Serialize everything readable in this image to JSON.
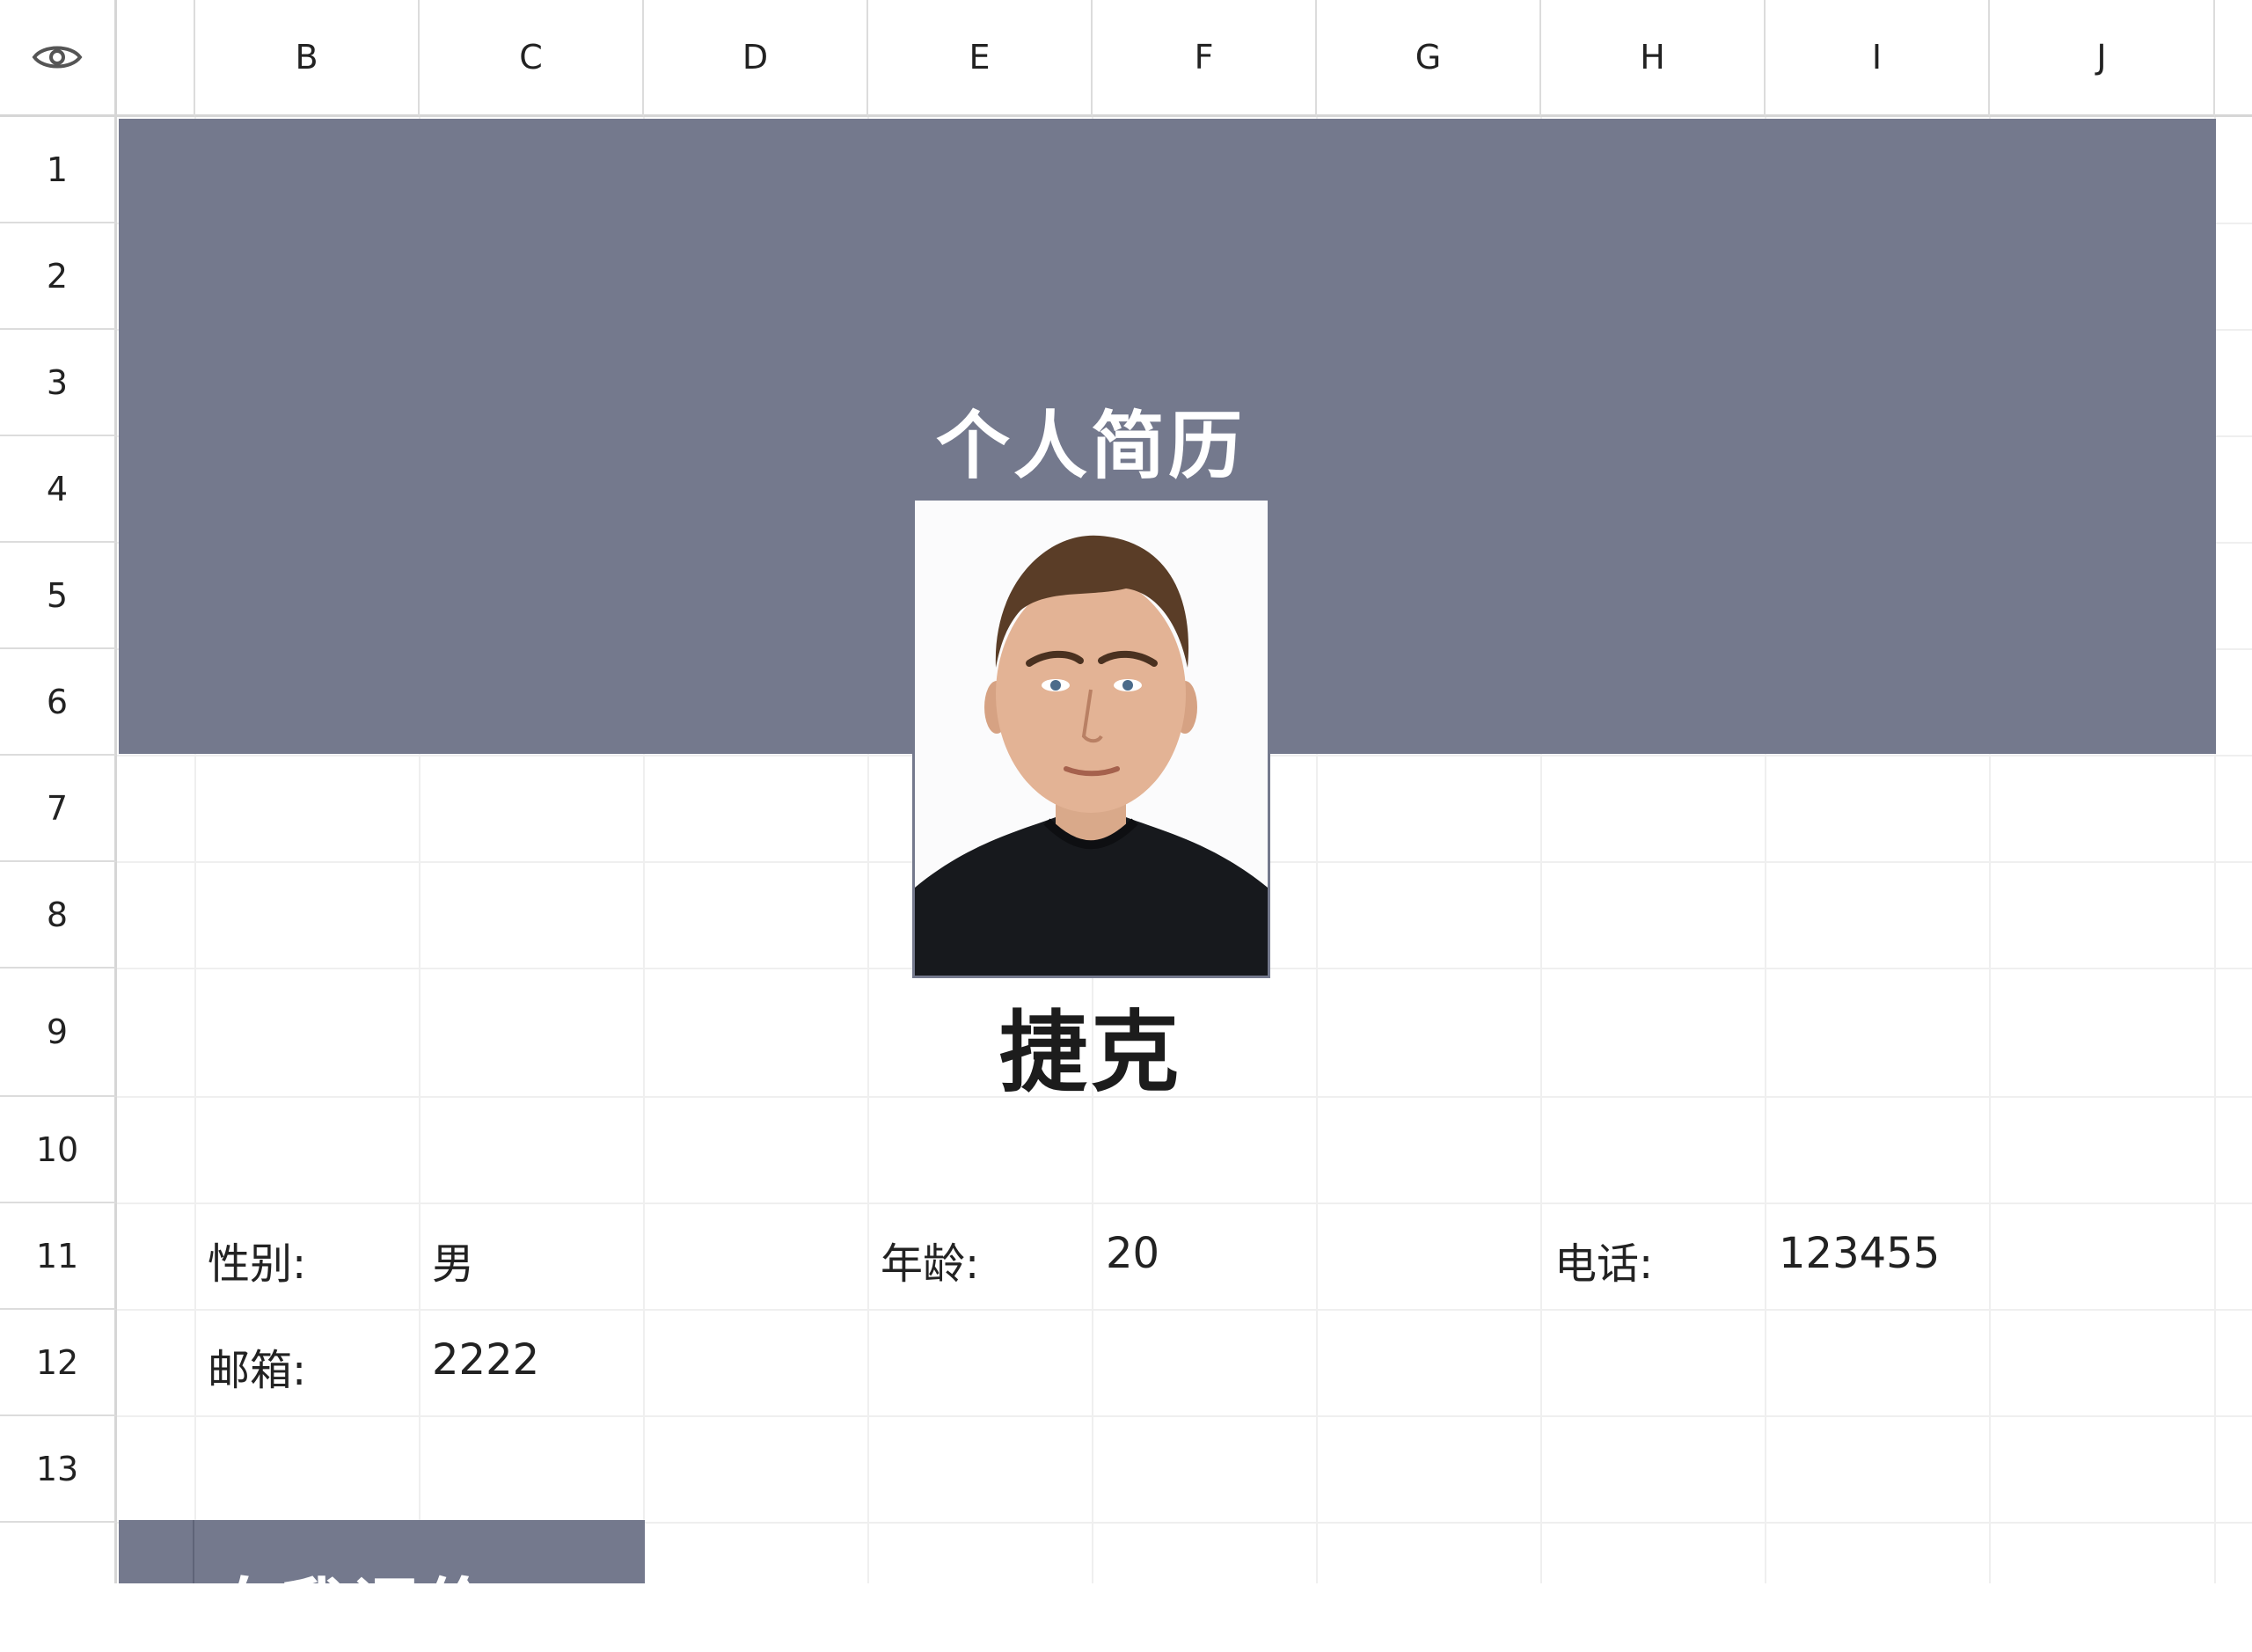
{
  "grid": {
    "columns": [
      "",
      "B",
      "C",
      "D",
      "E",
      "F",
      "G",
      "H",
      "I",
      "J"
    ],
    "rows": [
      "1",
      "2",
      "3",
      "4",
      "5",
      "6",
      "7",
      "8",
      "9",
      "10",
      "11",
      "12",
      "13"
    ]
  },
  "header": {
    "visibility_icon": "eye-icon"
  },
  "resume": {
    "title": "个人简历",
    "name": "捷克",
    "gender_label": "性别:",
    "gender_value": "男",
    "age_label": "年龄:",
    "age_value": "20",
    "phone_label": "电话:",
    "phone_value": "123455",
    "email_label": "邮箱:",
    "email_value": "2222",
    "section_title": "自我评价"
  },
  "colors": {
    "band": "#74798d",
    "grid_line": "#efefef",
    "header_border": "#d6d6d6"
  }
}
